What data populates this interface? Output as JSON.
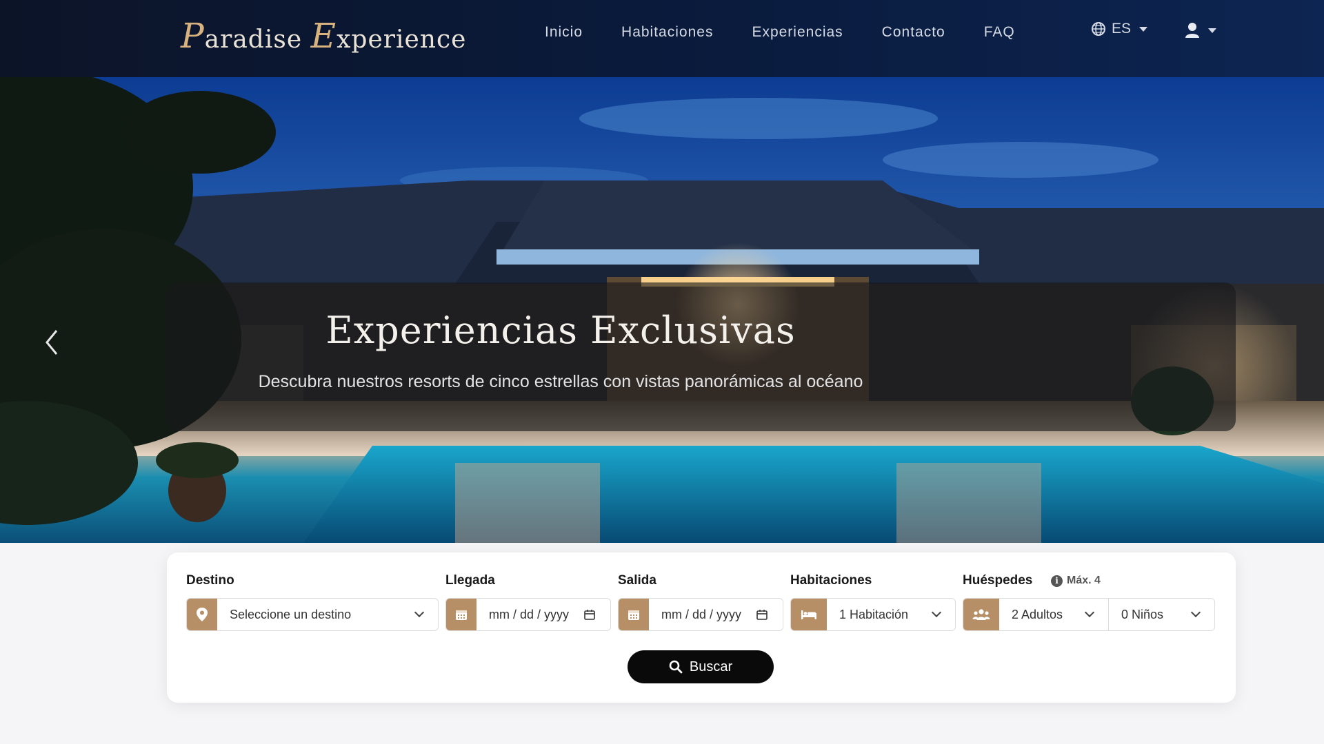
{
  "brand": {
    "first_cap": "P",
    "first_rest": "aradise",
    "second_cap": "E",
    "second_rest": "xperience"
  },
  "nav": {
    "items": [
      {
        "label": "Inicio"
      },
      {
        "label": "Habitaciones"
      },
      {
        "label": "Experiencias"
      },
      {
        "label": "Contacto"
      },
      {
        "label": "FAQ"
      }
    ],
    "language": "ES",
    "globe_icon": "globe-icon",
    "user_icon": "user-icon"
  },
  "hero": {
    "title": "Experiencias Exclusivas",
    "subtitle": "Descubra nuestros resorts de cinco estrellas con vistas panorámicas al océano",
    "prev_icon": "chevron-left-icon"
  },
  "search": {
    "destino": {
      "label": "Destino",
      "value": "Seleccione un destino"
    },
    "llegada": {
      "label": "Llegada",
      "placeholder": "mm / dd / yyyy"
    },
    "salida": {
      "label": "Salida",
      "placeholder": "mm / dd / yyyy"
    },
    "habitaciones": {
      "label": "Habitaciones",
      "value": "1 Habitación"
    },
    "huespedes": {
      "label": "Huéspedes",
      "max_note": "Máx. 4",
      "adults": "2 Adultos",
      "children": "0 Niños"
    },
    "button_label": "Buscar"
  },
  "colors": {
    "nav_bg": "#0a1b3d",
    "accent": "#b78f66",
    "brand_gold": "#d7b27e",
    "button_bg": "#0a0a0a"
  }
}
